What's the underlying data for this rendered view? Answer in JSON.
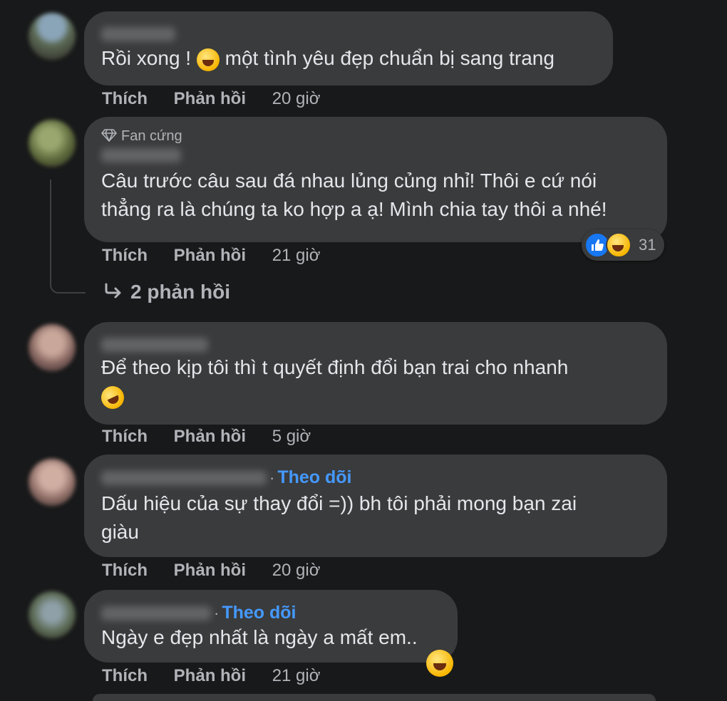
{
  "comments": [
    {
      "text": "Rồi xong ! ",
      "text_after": " một tình yêu đẹp chuẩn bị sang trang",
      "actions": {
        "like": "Thích",
        "reply": "Phản hồi",
        "time": "20 giờ"
      }
    },
    {
      "badge": "Fan cứng",
      "text": "Câu trước câu sau đá nhau lủng củng nhỉ! Thôi e cứ nói\nthẳng ra là chúng ta ko hợp a ạ! Mình chia tay thôi a nhé!",
      "reactions": {
        "count": "31",
        "icons": [
          "like-icon",
          "haha-icon"
        ]
      },
      "actions": {
        "like": "Thích",
        "reply": "Phản hồi",
        "time": "21 giờ"
      },
      "replies_label": "2 phản hồi"
    },
    {
      "text": "Để theo kịp tôi thì t quyết định đổi bạn trai cho nhanh",
      "actions": {
        "like": "Thích",
        "reply": "Phản hồi",
        "time": "5 giờ"
      }
    },
    {
      "follow": "Theo dõi",
      "text": "Dấu hiệu của sự thay đổi =)) bh tôi phải mong bạn zai\ngiàu",
      "actions": {
        "like": "Thích",
        "reply": "Phản hồi",
        "time": "20 giờ"
      }
    },
    {
      "follow": "Theo dõi",
      "text": "Ngày e đẹp nhất là ngày a mất em..",
      "actions": {
        "like": "Thích",
        "reply": "Phản hồi",
        "time": "21 giờ"
      }
    }
  ],
  "colors": {
    "background": "#18191a",
    "bubble": "#3a3b3c",
    "link": "#4599ff",
    "like_blue": "#1877f2"
  }
}
